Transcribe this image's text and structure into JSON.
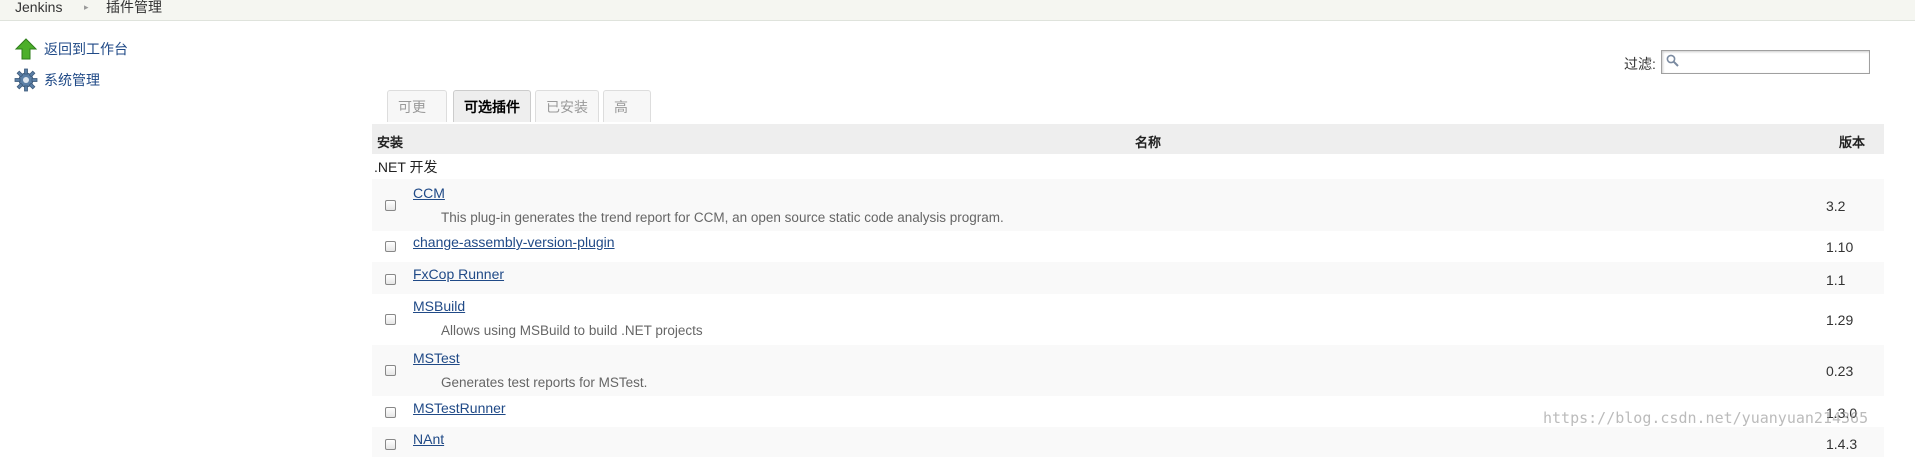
{
  "breadcrumb": [
    "Jenkins",
    "插件管理"
  ],
  "sidebar": {
    "items": [
      {
        "label": "返回到工作台",
        "icon": "up-arrow-icon"
      },
      {
        "label": "系统管理",
        "icon": "gear-icon"
      }
    ]
  },
  "filter": {
    "label": "过滤:",
    "value": "",
    "icon": "search-icon"
  },
  "tabs": [
    {
      "label": "可更新",
      "active": false
    },
    {
      "label": "可选插件",
      "active": true
    },
    {
      "label": "已安装",
      "active": false
    },
    {
      "label": "高级",
      "active": false
    }
  ],
  "table": {
    "headers": {
      "install": "安装",
      "name": "名称",
      "version": "版本"
    },
    "category": ".NET 开发",
    "rows": [
      {
        "name": "CCM",
        "description": "This plug-in generates the trend report for CCM, an open source static code analysis program.",
        "version": "3.2"
      },
      {
        "name": "change-assembly-version-plugin",
        "description": "",
        "version": "1.10"
      },
      {
        "name": "FxCop Runner",
        "description": "",
        "version": "1.1"
      },
      {
        "name": "MSBuild",
        "description": "Allows using MSBuild to build .NET projects",
        "version": "1.29"
      },
      {
        "name": "MSTest",
        "description": "Generates test reports for MSTest.",
        "version": "0.23"
      },
      {
        "name": "MSTestRunner",
        "description": "",
        "version": "1.3.0"
      },
      {
        "name": "NAnt",
        "description": "",
        "version": "1.4.3"
      }
    ]
  },
  "watermark": "https://blog.csdn.net/yuanyuan214365",
  "colors": {
    "link": "#204a87",
    "accent_green": "#4caf2a"
  }
}
